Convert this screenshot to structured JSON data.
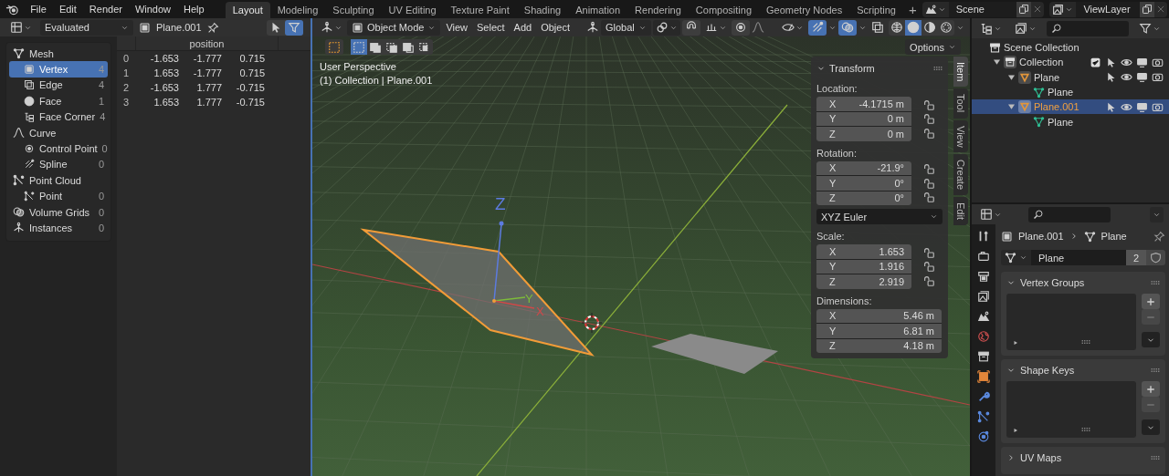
{
  "topbar": {
    "menus": [
      "File",
      "Edit",
      "Render",
      "Window",
      "Help"
    ],
    "workspaces": [
      {
        "label": "Layout",
        "selected": true
      },
      {
        "label": "Modeling",
        "selected": false
      },
      {
        "label": "Sculpting",
        "selected": false
      },
      {
        "label": "UV Editing",
        "selected": false
      },
      {
        "label": "Texture Paint",
        "selected": false
      },
      {
        "label": "Shading",
        "selected": false
      },
      {
        "label": "Animation",
        "selected": false
      },
      {
        "label": "Rendering",
        "selected": false
      },
      {
        "label": "Compositing",
        "selected": false
      },
      {
        "label": "Geometry Nodes",
        "selected": false
      },
      {
        "label": "Scripting",
        "selected": false
      }
    ],
    "add_workspace": "+",
    "scene": "Scene",
    "view_layer": "ViewLayer"
  },
  "spreadsheet": {
    "mode": "Evaluated",
    "object": "Plane.001",
    "filter_on": true,
    "domains": [
      {
        "label": "Mesh",
        "children": [
          {
            "label": "Vertex",
            "count": "4",
            "selected": true
          },
          {
            "label": "Edge",
            "count": "4",
            "selected": false
          },
          {
            "label": "Face",
            "count": "1",
            "selected": false
          },
          {
            "label": "Face Corner",
            "count": "4",
            "selected": false
          }
        ]
      },
      {
        "label": "Curve",
        "children": [
          {
            "label": "Control Point",
            "count": "0",
            "selected": false
          },
          {
            "label": "Spline",
            "count": "0",
            "selected": false
          }
        ]
      },
      {
        "label": "Point Cloud",
        "children": [
          {
            "label": "Point",
            "count": "0",
            "selected": false
          }
        ]
      },
      {
        "label": "Volume Grids",
        "count": "0"
      },
      {
        "label": "Instances",
        "count": "0"
      }
    ],
    "columns": [
      "position"
    ],
    "rows": [
      {
        "index": "0",
        "values": [
          "-1.653",
          "-1.777",
          "0.715"
        ]
      },
      {
        "index": "1",
        "values": [
          "1.653",
          "-1.777",
          "0.715"
        ]
      },
      {
        "index": "2",
        "values": [
          "-1.653",
          "1.777",
          "-0.715"
        ]
      },
      {
        "index": "3",
        "values": [
          "1.653",
          "1.777",
          "-0.715"
        ]
      }
    ]
  },
  "viewport": {
    "mode": "Object Mode",
    "menus": [
      "View",
      "Select",
      "Add",
      "Object"
    ],
    "orientation": "Global",
    "gizmos_on": true,
    "overlays_on": true,
    "shading_modes": [
      {
        "selected": false
      },
      {
        "selected": true
      },
      {
        "selected": false
      },
      {
        "selected": false
      }
    ],
    "select_modes": [
      {
        "selected": true
      },
      {
        "selected": false
      },
      {
        "selected": false
      },
      {
        "selected": false
      },
      {
        "selected": false
      }
    ],
    "options": "Options",
    "view_name": "User Perspective",
    "collection_info": "(1) Collection | Plane.001",
    "gizmo": {
      "z": "Z",
      "y": "Y",
      "x": "X"
    },
    "sidebar_tabs": [
      {
        "label": "Item",
        "selected": true
      },
      {
        "label": "Tool",
        "selected": false
      },
      {
        "label": "View",
        "selected": false
      },
      {
        "label": "Create",
        "selected": false
      },
      {
        "label": "Edit",
        "selected": false
      }
    ],
    "transform": {
      "title": "Transform",
      "groups": [
        {
          "label": "Location:",
          "lockable": true,
          "fields": [
            {
              "axis": "X",
              "value": "-4.1715 m"
            },
            {
              "axis": "Y",
              "value": "0 m"
            },
            {
              "axis": "Z",
              "value": "0 m"
            }
          ]
        },
        {
          "label": "Rotation:",
          "lockable": true,
          "fields": [
            {
              "axis": "X",
              "value": "-21.9°"
            },
            {
              "axis": "Y",
              "value": "0°"
            },
            {
              "axis": "Z",
              "value": "0°"
            }
          ],
          "mode": "XYZ Euler"
        },
        {
          "label": "Scale:",
          "lockable": true,
          "fields": [
            {
              "axis": "X",
              "value": "1.653"
            },
            {
              "axis": "Y",
              "value": "1.916"
            },
            {
              "axis": "Z",
              "value": "2.919"
            }
          ]
        },
        {
          "label": "Dimensions:",
          "lockable": false,
          "fields": [
            {
              "axis": "X",
              "value": "5.46 m"
            },
            {
              "axis": "Y",
              "value": "6.81 m"
            },
            {
              "axis": "Z",
              "value": "4.18 m"
            }
          ]
        }
      ]
    }
  },
  "outliner": {
    "items": [
      {
        "label": "Scene Collection",
        "kind": "scene_collection",
        "selected": false,
        "children": [
          {
            "label": "Collection",
            "kind": "collection",
            "selected": false,
            "checked": true,
            "expanded": true,
            "children": [
              {
                "label": "Plane",
                "kind": "object",
                "selected": false,
                "expanded": true,
                "children": [
                  {
                    "label": "Plane",
                    "kind": "mesh",
                    "selected": false
                  }
                ]
              },
              {
                "label": "Plane.001",
                "kind": "object",
                "selected": true,
                "expanded": true,
                "children": [
                  {
                    "label": "Plane",
                    "kind": "mesh",
                    "selected": false
                  }
                ]
              }
            ]
          }
        ]
      }
    ]
  },
  "properties": {
    "breadcrumb": [
      "Plane.001",
      "Plane"
    ],
    "datablock": {
      "name": "Plane",
      "users": "2"
    },
    "panels": [
      {
        "title": "Vertex Groups",
        "expanded": true
      },
      {
        "title": "Shape Keys",
        "expanded": true
      },
      {
        "title": "UV Maps",
        "expanded": false
      }
    ]
  }
}
